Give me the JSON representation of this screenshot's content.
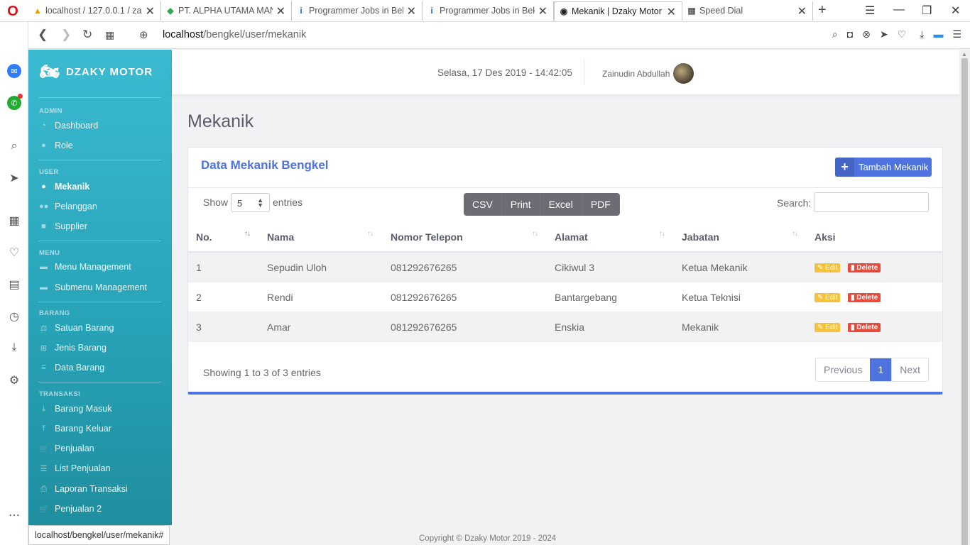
{
  "browser": {
    "tabs": [
      {
        "title": "localhost / 127.0.0.1 / za",
        "favicon": "phpmyadmin-icon"
      },
      {
        "title": "PT. ALPHA UTAMA MAN",
        "favicon": "maps-icon"
      },
      {
        "title": "Programmer Jobs in Bek",
        "favicon": "indeed-icon"
      },
      {
        "title": "Programmer Jobs in Bek",
        "favicon": "indeed-icon"
      },
      {
        "title": "Mekanik | Dzaky Motor",
        "favicon": "site-icon"
      },
      {
        "title": "Speed Dial",
        "favicon": "speed-dial-icon"
      }
    ],
    "active_tab": 4,
    "url_host": "localhost",
    "url_path": "/bengkel/user/mekanik",
    "status_url": "localhost/bengkel/user/mekanik#"
  },
  "sidebar": {
    "brand": "DZAKY MOTOR",
    "sections": {
      "admin": "ADMIN",
      "user": "USER",
      "menu": "MENU",
      "barang": "BARANG",
      "transaksi": "TRANSAKSI"
    },
    "items": {
      "dashboard": "Dashboard",
      "role": "Role",
      "mekanik": "Mekanik",
      "pelanggan": "Pelanggan",
      "supplier": "Supplier",
      "menu_management": "Menu Management",
      "submenu_management": "Submenu Management",
      "satuan_barang": "Satuan Barang",
      "jenis_barang": "Jenis Barang",
      "data_barang": "Data Barang",
      "barang_masuk": "Barang Masuk",
      "barang_keluar": "Barang Keluar",
      "penjualan": "Penjualan",
      "list_penjualan": "List Penjualan",
      "laporan_transaksi": "Laporan Transaksi",
      "penjualan_2": "Penjualan 2"
    }
  },
  "topbar": {
    "datetime": "Selasa, 17 Des 2019 - 14:42:05",
    "username": "Zainudin Abdullah"
  },
  "page": {
    "title": "Mekanik"
  },
  "card": {
    "title": "Data Mekanik Bengkel",
    "add_button": "Tambah Mekanik",
    "show_label": "Show",
    "entries_value": "5",
    "entries_label": "entries",
    "export_buttons": {
      "csv": "CSV",
      "print": "Print",
      "excel": "Excel",
      "pdf": "PDF"
    },
    "search_label": "Search:",
    "search_value": "",
    "columns": {
      "no": "No.",
      "nama": "Nama",
      "telepon": "Nomor Telepon",
      "alamat": "Alamat",
      "jabatan": "Jabatan",
      "aksi": "Aksi"
    },
    "rows": [
      {
        "no": "1",
        "nama": "Sepudin Uloh",
        "telepon": "081292676265",
        "alamat": "Cikiwul 3",
        "jabatan": "Ketua Mekanik"
      },
      {
        "no": "2",
        "nama": "Rendi",
        "telepon": "081292676265",
        "alamat": "Bantargebang",
        "jabatan": "Ketua Teknisi"
      },
      {
        "no": "3",
        "nama": "Amar",
        "telepon": "081292676265",
        "alamat": "Enskia",
        "jabatan": "Mekanik"
      }
    ],
    "edit_label": "Edit",
    "delete_label": "Delete",
    "info": "Showing 1 to 3 of 3 entries",
    "pagination": {
      "previous": "Previous",
      "current": "1",
      "next": "Next"
    }
  },
  "footer": {
    "copyright": "Copyright © Dzaky Motor 2019 - 2024"
  },
  "colors": {
    "primary": "#4e73df",
    "sidebar": "#36b9cc",
    "edit": "#f6c23e",
    "delete": "#e74a3b"
  }
}
